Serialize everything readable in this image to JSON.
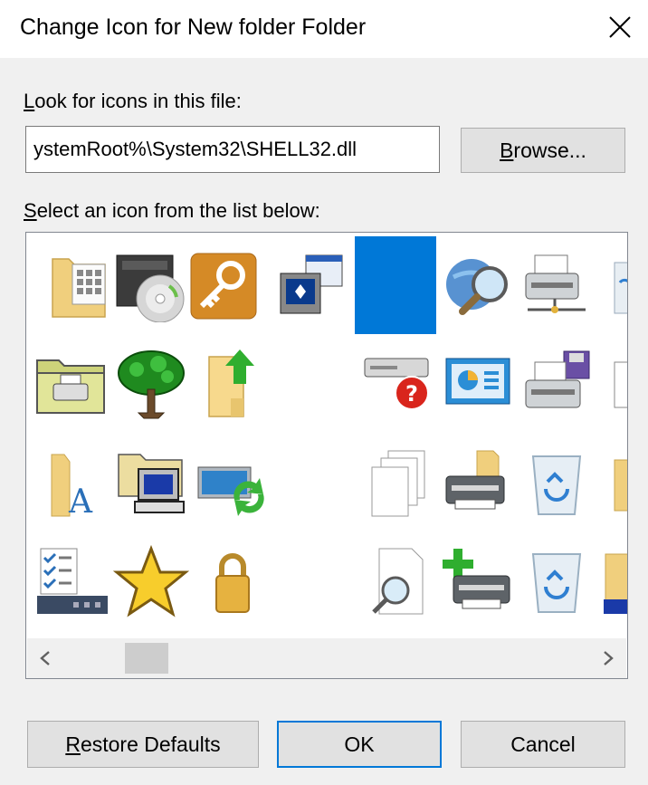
{
  "window": {
    "title": "Change Icon for New folder Folder",
    "close_icon": "close-icon"
  },
  "file_section": {
    "label_mnemonic": "L",
    "label_rest": "ook for icons in this file:",
    "path_value": "ystemRoot%\\System32\\SHELL32.dll",
    "browse_mnemonic": "B",
    "browse_rest": "rowse..."
  },
  "list_section": {
    "label_mnemonic": "S",
    "label_rest": "elect an icon from the list below:",
    "selected_index": 4,
    "icons": [
      [
        "folder-grid-icon",
        "cd-drive-icon",
        "key-icon",
        "computer-window-icon",
        "blank-selected-icon",
        "search-globe-icon",
        "network-printer-icon",
        "recycle-bin-partial-icon"
      ],
      [
        "folder-printer-icon",
        "tree-icon",
        "folder-upload-icon",
        "blank-icon",
        "drive-help-icon",
        "control-panel-icon",
        "printer-disk-icon",
        "document-partial-icon"
      ],
      [
        "folder-font-icon",
        "folder-computer-icon",
        "network-sync-icon",
        "blank-icon",
        "copy-pages-icon",
        "printer-folder-icon",
        "recycle-bin-icon",
        "folder-partial-icon"
      ],
      [
        "checklist-icon",
        "star-icon",
        "lock-icon",
        "blank-icon",
        "search-document-icon",
        "add-printer-icon",
        "recycle-bin-icon",
        "folder-film-partial-icon"
      ]
    ]
  },
  "scrollbar": {
    "left_arrow": "chevron-left-icon",
    "right_arrow": "chevron-right-icon"
  },
  "buttons": {
    "restore_mnemonic": "R",
    "restore_rest": "estore Defaults",
    "ok": "OK",
    "cancel": "Cancel"
  },
  "colors": {
    "selection": "#0078d7",
    "dialog_bg": "#f0f0f0"
  }
}
